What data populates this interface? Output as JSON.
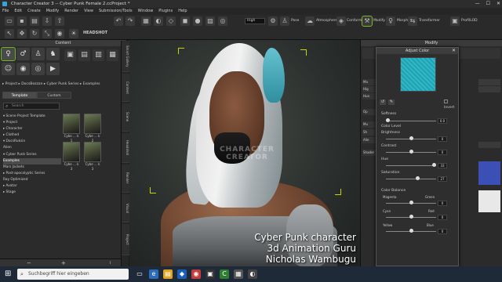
{
  "window": {
    "title": "Character Creator 3 -- Cyber Punk Female 2.ccProject *",
    "minimize": "—",
    "maximize": "☐",
    "close": "✕"
  },
  "menu": [
    "File",
    "Edit",
    "Create",
    "Modify",
    "Render",
    "View",
    "Submission/Tools",
    "Window",
    "Plugins",
    "Help"
  ],
  "toolbar": {
    "quality_value": "High",
    "headshot": "HEADSHOT",
    "pose": "Pose",
    "atmosphere": "Atmosphere",
    "conform": "Conform",
    "morph": "Morph",
    "transformer": "Transformer",
    "pipeline": "ProfilLOD"
  },
  "content": {
    "title": "Content",
    "breadcrumb": "▸  Project  ▸  DocsBezzan  ▸  Cyber Punk Series  ▸  Examples",
    "tabs": [
      "Template",
      "Custom"
    ],
    "search_placeholder": "Search",
    "tree": [
      "▾ Scene Project Template",
      "▾ Project",
      "  ▸ Character",
      "  ▸ Clothed",
      "  ▾ DocsRuksin",
      "      Alien",
      "    ▾ Cyber Punk Series",
      "        Examples",
      "      Mars Jackets",
      "    ▸ Post-apocalyptic Series",
      "      Ray Optimized",
      "▸ Avatar",
      "▸ Stage"
    ],
    "thumbnails": [
      "Cybe ... k 1",
      "Cybe ... k 2",
      "Cybe ... k 3",
      "Cybe ... k 3"
    ],
    "footer_minus": "−",
    "footer_plus": "+",
    "footer_info": "i"
  },
  "side_tabs": [
    "Smart Gallery",
    "Content",
    "Scene",
    "Headshot",
    "Render",
    "Visual",
    "Project"
  ],
  "viewport": {
    "watermark_line1": "CHARACTER",
    "watermark_line2": "CREATOR"
  },
  "credits": [
    "Cyber Punk character",
    "3d Animation Guru",
    "Nicholas Wambugu"
  ],
  "modify": {
    "title": "Modify",
    "side_labels": [
      "Ma",
      "Hig",
      "Hua",
      "Op",
      "Mu",
      "Sh",
      "Alle",
      "Shader"
    ]
  },
  "adjust_color": {
    "title": "Adjust Color",
    "swatch_color": "#2aa9b8",
    "invert": "Invert",
    "softness_label": "Softness",
    "softness_value": "0.0",
    "color_level": "Color Level",
    "brightness_label": "Brightness",
    "brightness_value": "0",
    "contrast_label": "Contrast",
    "contrast_value": "0",
    "hue_label": "Hue",
    "hue_value": "33",
    "saturation_label": "Saturation",
    "saturation_value": "27",
    "color_balance": "Color Balance",
    "magenta": "Magenta",
    "green": "Green",
    "mg_value": "0",
    "cyan": "Cyan",
    "red": "Red",
    "cr_value": "0",
    "yellow": "Yellow",
    "blue": "Blue",
    "yb_value": "0"
  },
  "taskbar": {
    "search_placeholder": "Suchbegriff hier eingeben"
  }
}
